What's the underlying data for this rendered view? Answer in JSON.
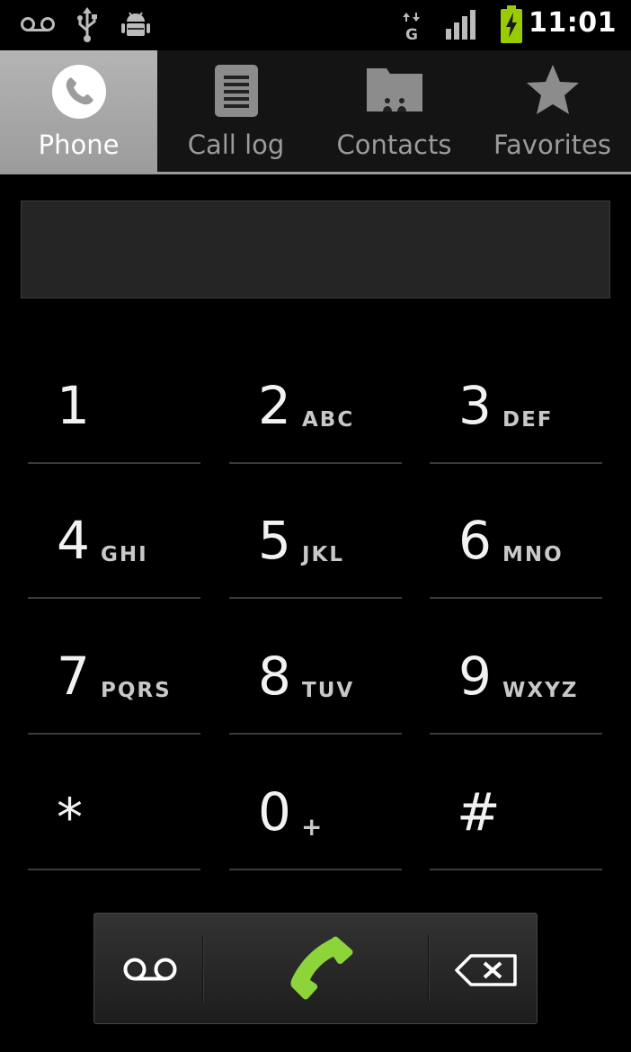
{
  "status_bar": {
    "icons": [
      "voicemail-icon",
      "usb-icon",
      "android-debug-icon",
      "data-transfer-icon",
      "signal-icon",
      "battery-charging-icon"
    ],
    "network_label": "G",
    "time": "11:01",
    "battery_color": "#99cc00"
  },
  "tabs": [
    {
      "label": "Phone",
      "icon": "phone-icon",
      "active": true
    },
    {
      "label": "Call log",
      "icon": "call-log-icon",
      "active": false
    },
    {
      "label": "Contacts",
      "icon": "contacts-icon",
      "active": false
    },
    {
      "label": "Favorites",
      "icon": "star-icon",
      "active": false
    }
  ],
  "digits_field": {
    "value": ""
  },
  "keypad": [
    {
      "digit": "1",
      "letters": ""
    },
    {
      "digit": "2",
      "letters": "ABC"
    },
    {
      "digit": "3",
      "letters": "DEF"
    },
    {
      "digit": "4",
      "letters": "GHI"
    },
    {
      "digit": "5",
      "letters": "JKL"
    },
    {
      "digit": "6",
      "letters": "MNO"
    },
    {
      "digit": "7",
      "letters": "PQRS"
    },
    {
      "digit": "8",
      "letters": "TUV"
    },
    {
      "digit": "9",
      "letters": "WXYZ"
    },
    {
      "digit": "*",
      "letters": ""
    },
    {
      "digit": "0",
      "letters": "+"
    },
    {
      "digit": "#",
      "letters": ""
    }
  ],
  "action_bar": {
    "voicemail_icon": "voicemail-icon",
    "call_icon": "phone-icon",
    "call_color": "#8dd43b",
    "delete_icon": "backspace-icon"
  }
}
